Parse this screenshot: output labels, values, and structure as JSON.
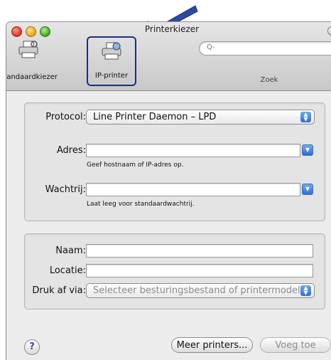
{
  "window": {
    "title": "Printerkiezer"
  },
  "toolbar": {
    "standard_label": "Standaardkiezer",
    "ip_label": "IP-printer",
    "search_placeholder": "Q-",
    "search_label": "Zoek"
  },
  "form": {
    "protocol_label": "Protocol:",
    "protocol_value": "Line Printer Daemon – LPD",
    "address_label": "Adres:",
    "address_value": "",
    "address_hint": "Geef hostnaam of IP-adres op.",
    "queue_label": "Wachtrij:",
    "queue_value": "",
    "queue_hint": "Laat leeg voor standaardwachtrij.",
    "name_label": "Naam:",
    "name_value": "",
    "location_label": "Locatie:",
    "location_value": "",
    "print_via_label": "Druk af via:",
    "print_via_value": "Selecteer besturingsbestand of printermodel"
  },
  "footer": {
    "help_label": "?",
    "more_printers_label": "Meer printers...",
    "add_label": "Voeg toe"
  },
  "colors": {
    "highlight_border": "#1a2f7a",
    "arrow": "#2b4aa0"
  },
  "icons": [
    "printer-icon",
    "ip-printer-icon",
    "search-icon",
    "help-icon",
    "popup-arrows-icon",
    "combo-arrow-icon",
    "pointer-arrow-icon"
  ]
}
